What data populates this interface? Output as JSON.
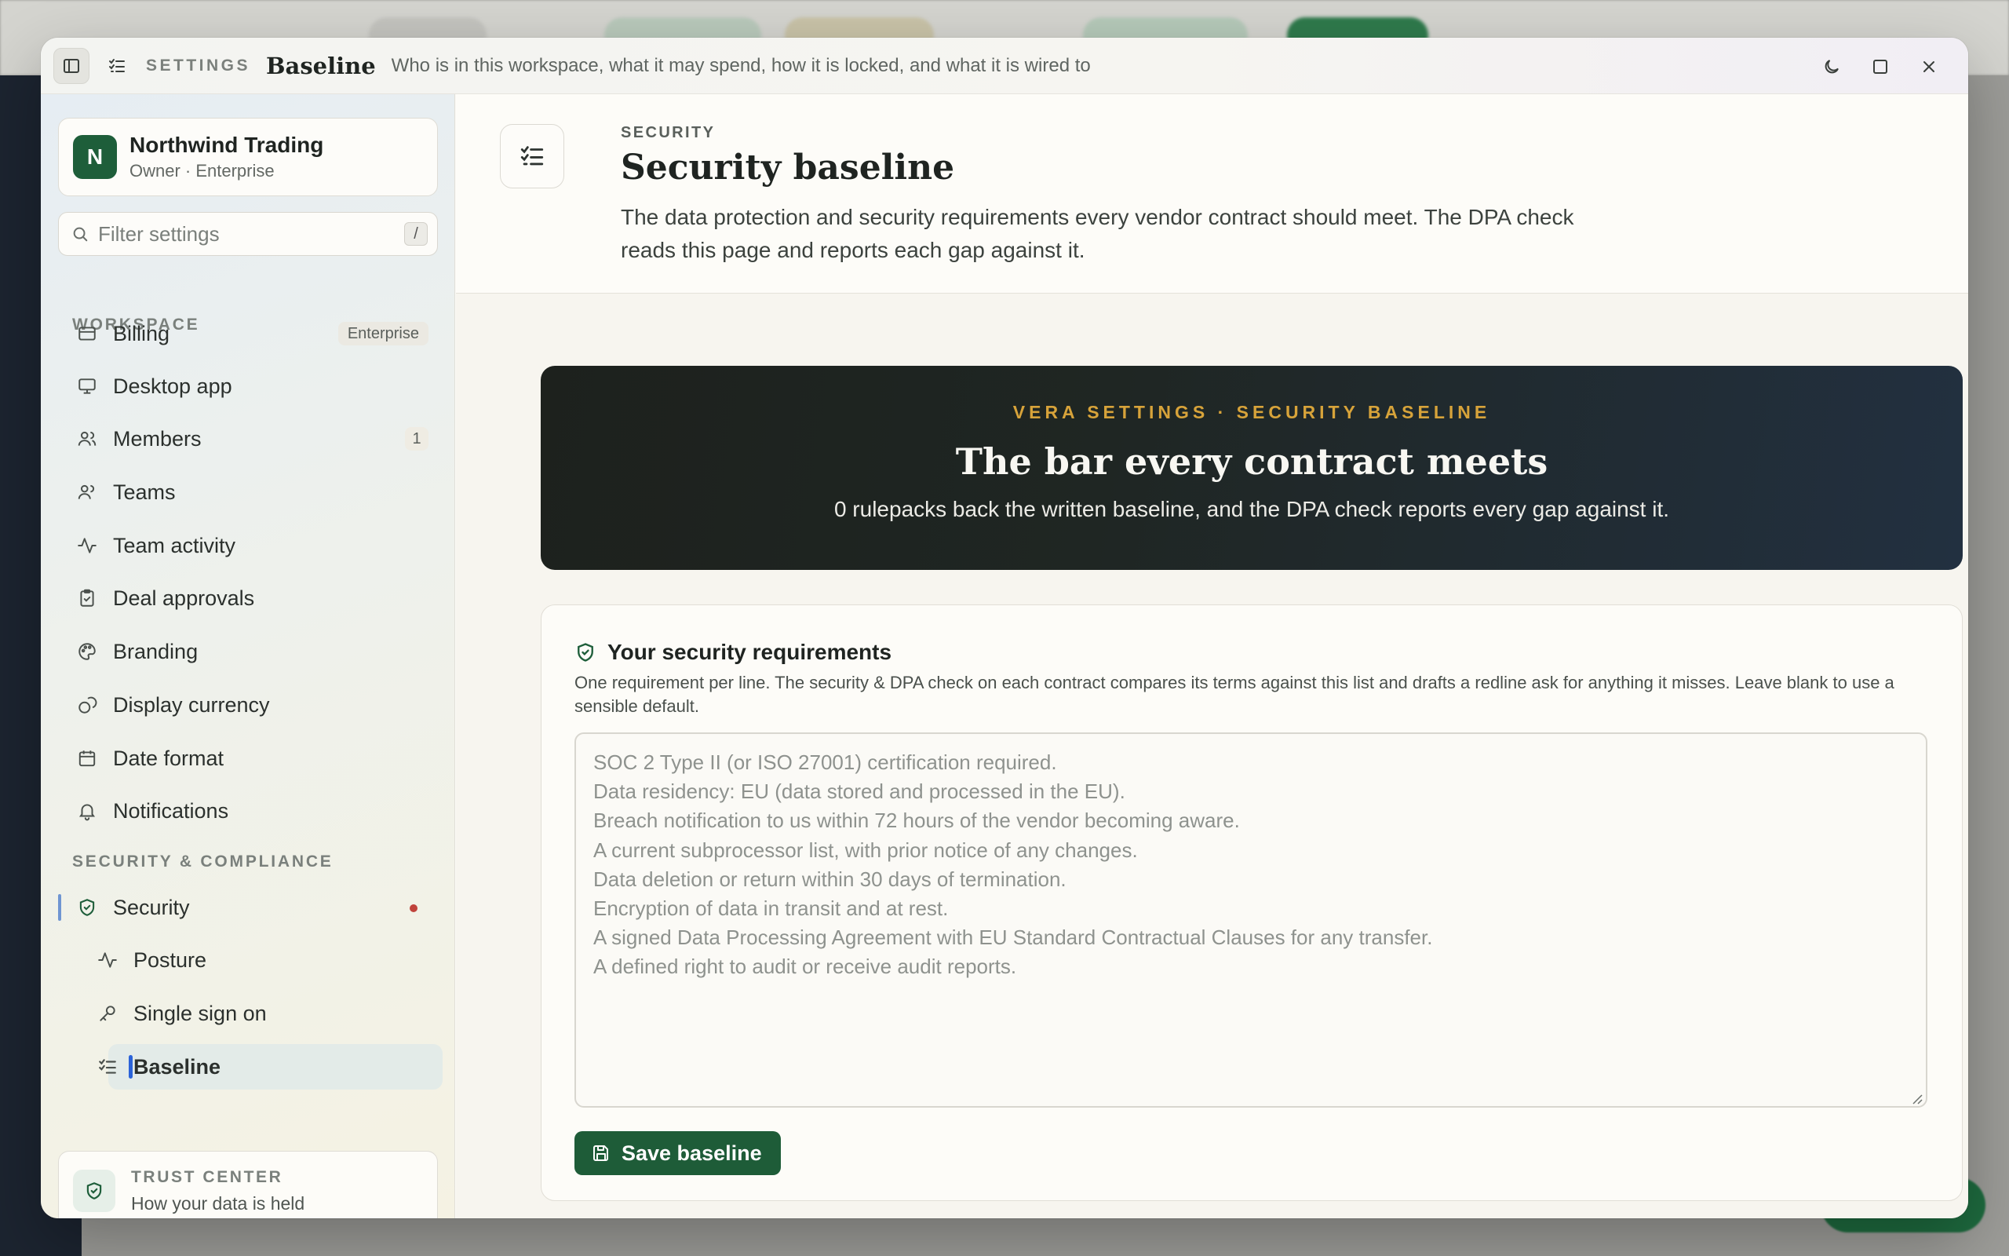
{
  "titlebar": {
    "section": "SETTINGS",
    "page": "Baseline",
    "description": "Who is in this workspace, what it may spend, how it is locked, and what it is wired to"
  },
  "workspace": {
    "initial": "N",
    "name": "Northwind Trading",
    "role": "Owner · Enterprise"
  },
  "filter": {
    "placeholder": "Filter settings",
    "shortcut": "/"
  },
  "sidebar": {
    "workspace_label": "WORKSPACE",
    "items": [
      {
        "label": "Billing",
        "icon": "credit-card-icon",
        "badge": "Enterprise"
      },
      {
        "label": "Desktop app",
        "icon": "monitor-icon"
      },
      {
        "label": "Members",
        "icon": "users-icon",
        "count": "1"
      },
      {
        "label": "Teams",
        "icon": "team-icon"
      },
      {
        "label": "Team activity",
        "icon": "activity-icon"
      },
      {
        "label": "Deal approvals",
        "icon": "clipboard-check-icon"
      },
      {
        "label": "Branding",
        "icon": "palette-icon"
      },
      {
        "label": "Display currency",
        "icon": "coins-icon"
      },
      {
        "label": "Date format",
        "icon": "calendar-icon"
      },
      {
        "label": "Notifications",
        "icon": "bell-icon"
      }
    ],
    "security_label": "SECURITY & COMPLIANCE",
    "security": {
      "label": "Security",
      "icon": "shield-check-icon"
    },
    "security_sub": [
      {
        "label": "Posture",
        "icon": "activity-icon"
      },
      {
        "label": "Single sign on",
        "icon": "key-icon"
      },
      {
        "label": "Baseline",
        "icon": "list-check-icon"
      }
    ]
  },
  "trust": {
    "title": "TRUST CENTER",
    "subtitle": "How your data is held"
  },
  "header": {
    "eyebrow": "SECURITY",
    "title": "Security baseline",
    "description": "The data protection and security requirements every vendor contract should meet. The DPA check reads this page and reports each gap against it."
  },
  "hero": {
    "kicker": "VERA SETTINGS · SECURITY BASELINE",
    "title": "The bar every contract meets",
    "subtitle": "0 rulepacks back the written baseline, and the DPA check reports every gap against it."
  },
  "requirements": {
    "title": "Your security requirements",
    "help": "One requirement per line. The security & DPA check on each contract compares its terms against this list and drafts a redline ask for anything it misses. Leave blank to use a sensible default.",
    "value": "",
    "placeholder": "SOC 2 Type II (or ISO 27001) certification required.\nData residency: EU (data stored and processed in the EU).\nBreach notification to us within 72 hours of the vendor becoming aware.\nA current subprocessor list, with prior notice of any changes.\nData deletion or return within 30 days of termination.\nEncryption of data in transit and at rest.\nA signed Data Processing Agreement with EU Standard Contractual Clauses for any transfer.\nA defined right to audit or receive audit reports.",
    "save_label": "Save baseline"
  },
  "colors": {
    "brand_green": "#1e5c38",
    "hero_accent": "#d7a33a",
    "alert_dot": "#c0433b",
    "active_indicator": "#2b63d9"
  }
}
